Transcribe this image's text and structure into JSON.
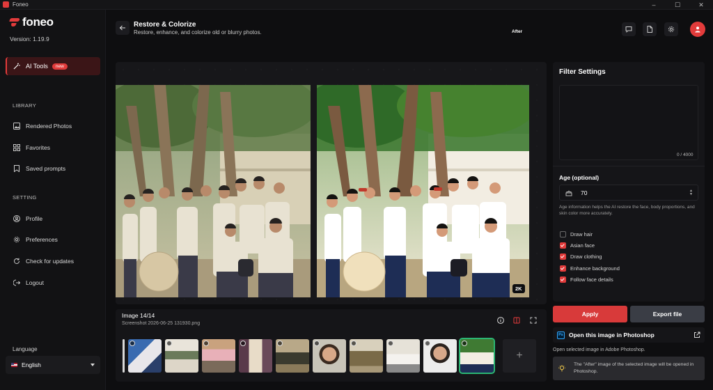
{
  "window": {
    "title": "Foneo",
    "controls": [
      "–",
      "☐",
      "✕"
    ]
  },
  "sidebar": {
    "logo": "foneo",
    "version": "Version: 1.19.9",
    "ai_tools": {
      "label": "AI Tools",
      "badge": "new"
    },
    "library_title": "LIBRARY",
    "library_items": [
      {
        "label": "Rendered Photos",
        "icon": "image-icon"
      },
      {
        "label": "Favorites",
        "icon": "grid-icon"
      },
      {
        "label": "Saved prompts",
        "icon": "bookmark-icon"
      }
    ],
    "setting_title": "SETTING",
    "setting_items": [
      {
        "label": "Profile",
        "icon": "user-icon"
      },
      {
        "label": "Preferences",
        "icon": "gear-icon"
      },
      {
        "label": "Check for updates",
        "icon": "refresh-icon"
      },
      {
        "label": "Logout",
        "icon": "logout-icon"
      }
    ],
    "language_label": "Language",
    "language_value": "English"
  },
  "header": {
    "title": "Restore & Colorize",
    "subtitle": "Restore, enhance, and colorize old or blurry photos."
  },
  "compare": {
    "after_tag": "After",
    "resolution_tag": "2K"
  },
  "image_info": {
    "count": "Image 14/14",
    "filename": "Screenshot 2026-06-25 131930.png",
    "add_label": "+"
  },
  "filter": {
    "title": "Filter Settings",
    "char_count": "0 / 4000",
    "age_label": "Age (optional)",
    "age_value": "70",
    "age_help": "Age information helps the AI restore the face, body proportions, and skin color more accurately.",
    "options": [
      {
        "label": "Draw hair",
        "checked": false
      },
      {
        "label": "Asian face",
        "checked": true
      },
      {
        "label": "Draw clothing",
        "checked": true
      },
      {
        "label": "Enhance background",
        "checked": true
      },
      {
        "label": "Follow face details",
        "checked": true
      }
    ],
    "apply_label": "Apply",
    "export_label": "Export file",
    "photoshop_label": "Open this image in Photoshop",
    "photoshop_badge": "Ps",
    "photoshop_help": "Open selected image in Adobe Photoshop.",
    "tip": "The \"After\" image of the selected image will be opened in Photoshop."
  },
  "colors": {
    "accent": "#e23b3b",
    "selected": "#2bb673",
    "panel": "#151518"
  }
}
